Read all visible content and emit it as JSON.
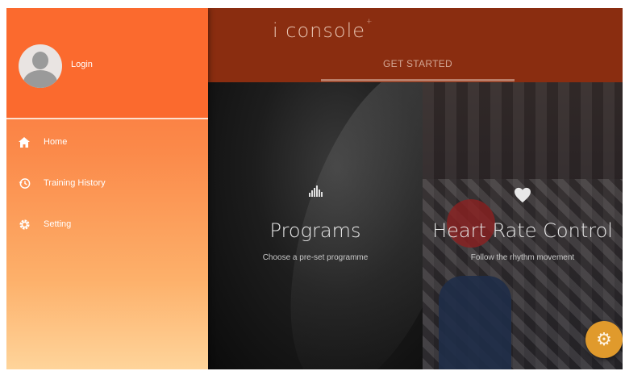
{
  "app": {
    "brand": "i console",
    "brand_mark": "+"
  },
  "tabs": [
    {
      "label": "GET STARTED",
      "active": true
    }
  ],
  "drawer": {
    "login_label": "Login",
    "items": [
      {
        "label": "Home",
        "icon": "home-icon"
      },
      {
        "label": "Training History",
        "icon": "history-icon"
      },
      {
        "label": "Setting",
        "icon": "gear-icon"
      }
    ]
  },
  "tiles": [
    {
      "title": "Programs",
      "subtitle": "Choose a pre-set programme",
      "icon": "bars-icon"
    },
    {
      "title": "Heart Rate Control",
      "subtitle": "Follow the rhythm movement",
      "icon": "heart-icon"
    }
  ],
  "fab": {
    "icon": "gear-icon"
  },
  "colors": {
    "accent": "#fb6a2e",
    "appbar": "#8a2d10",
    "fab": "#e09a2c"
  }
}
